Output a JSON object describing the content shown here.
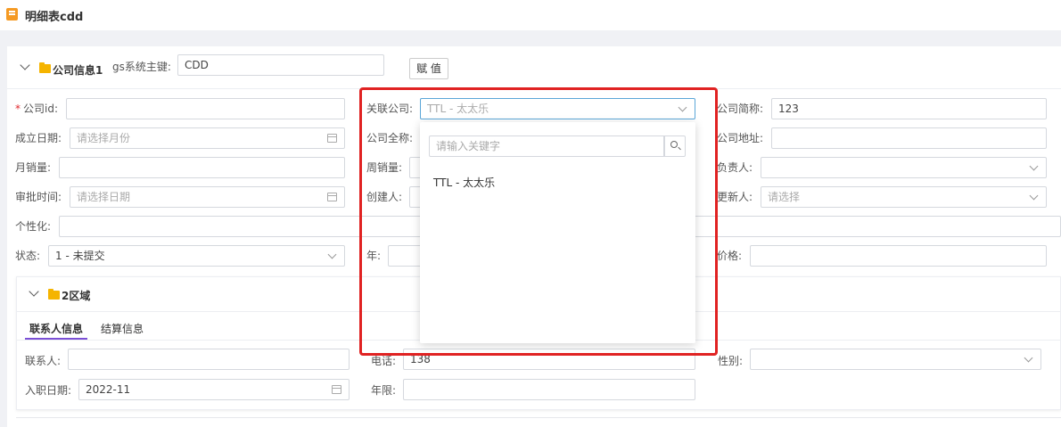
{
  "page_title": "明细表cdd",
  "section1": {
    "title": "公司信息1",
    "pk_label": "gs系统主键:",
    "pk_value": "CDD",
    "assign_button": "赋 值"
  },
  "fields": {
    "company_id": {
      "label": "公司id:",
      "value": ""
    },
    "related_company": {
      "label": "关联公司:",
      "value": "TTL - 太太乐"
    },
    "company_short": {
      "label": "公司简称:",
      "value": "123"
    },
    "founded_date": {
      "label": "成立日期:",
      "placeholder": "请选择月份"
    },
    "company_full": {
      "label": "公司全称:"
    },
    "company_address": {
      "label": "公司地址:",
      "value": ""
    },
    "monthly_sales": {
      "label": "月销量:",
      "value": ""
    },
    "weekly_sales": {
      "label": "周销量:"
    },
    "owner": {
      "label": "负责人:"
    },
    "approval_time": {
      "label": "审批时间:",
      "placeholder": "请选择日期"
    },
    "creator": {
      "label": "创建人:"
    },
    "updater": {
      "label": "更新人:",
      "placeholder": "请选择"
    },
    "personalize": {
      "label": "个性化:",
      "value": ""
    },
    "status": {
      "label": "状态:",
      "value": "1 - 未提交"
    },
    "year": {
      "label": "年:"
    },
    "price": {
      "label": "价格:",
      "value": ""
    }
  },
  "section2": {
    "title": "2区域",
    "tabs": [
      "联系人信息",
      "结算信息"
    ],
    "active_tab": 0,
    "contact": {
      "label": "联系人:",
      "value": ""
    },
    "phone": {
      "label": "电话:",
      "value": "138"
    },
    "gender": {
      "label": "性别:",
      "value": ""
    },
    "hire_date": {
      "label": "入职日期:",
      "value": "2022-11"
    },
    "tenure": {
      "label": "年限:",
      "value": ""
    }
  },
  "dropdown": {
    "search_placeholder": "请输入关键字",
    "options": [
      "TTL - 太太乐"
    ]
  },
  "colors": {
    "accent": "#7b4fd6",
    "required": "#e0282e",
    "highlight": "#e02222",
    "folder": "#f5b400",
    "title_icon": "#f59a23",
    "focus_border": "#5aa6d8"
  }
}
